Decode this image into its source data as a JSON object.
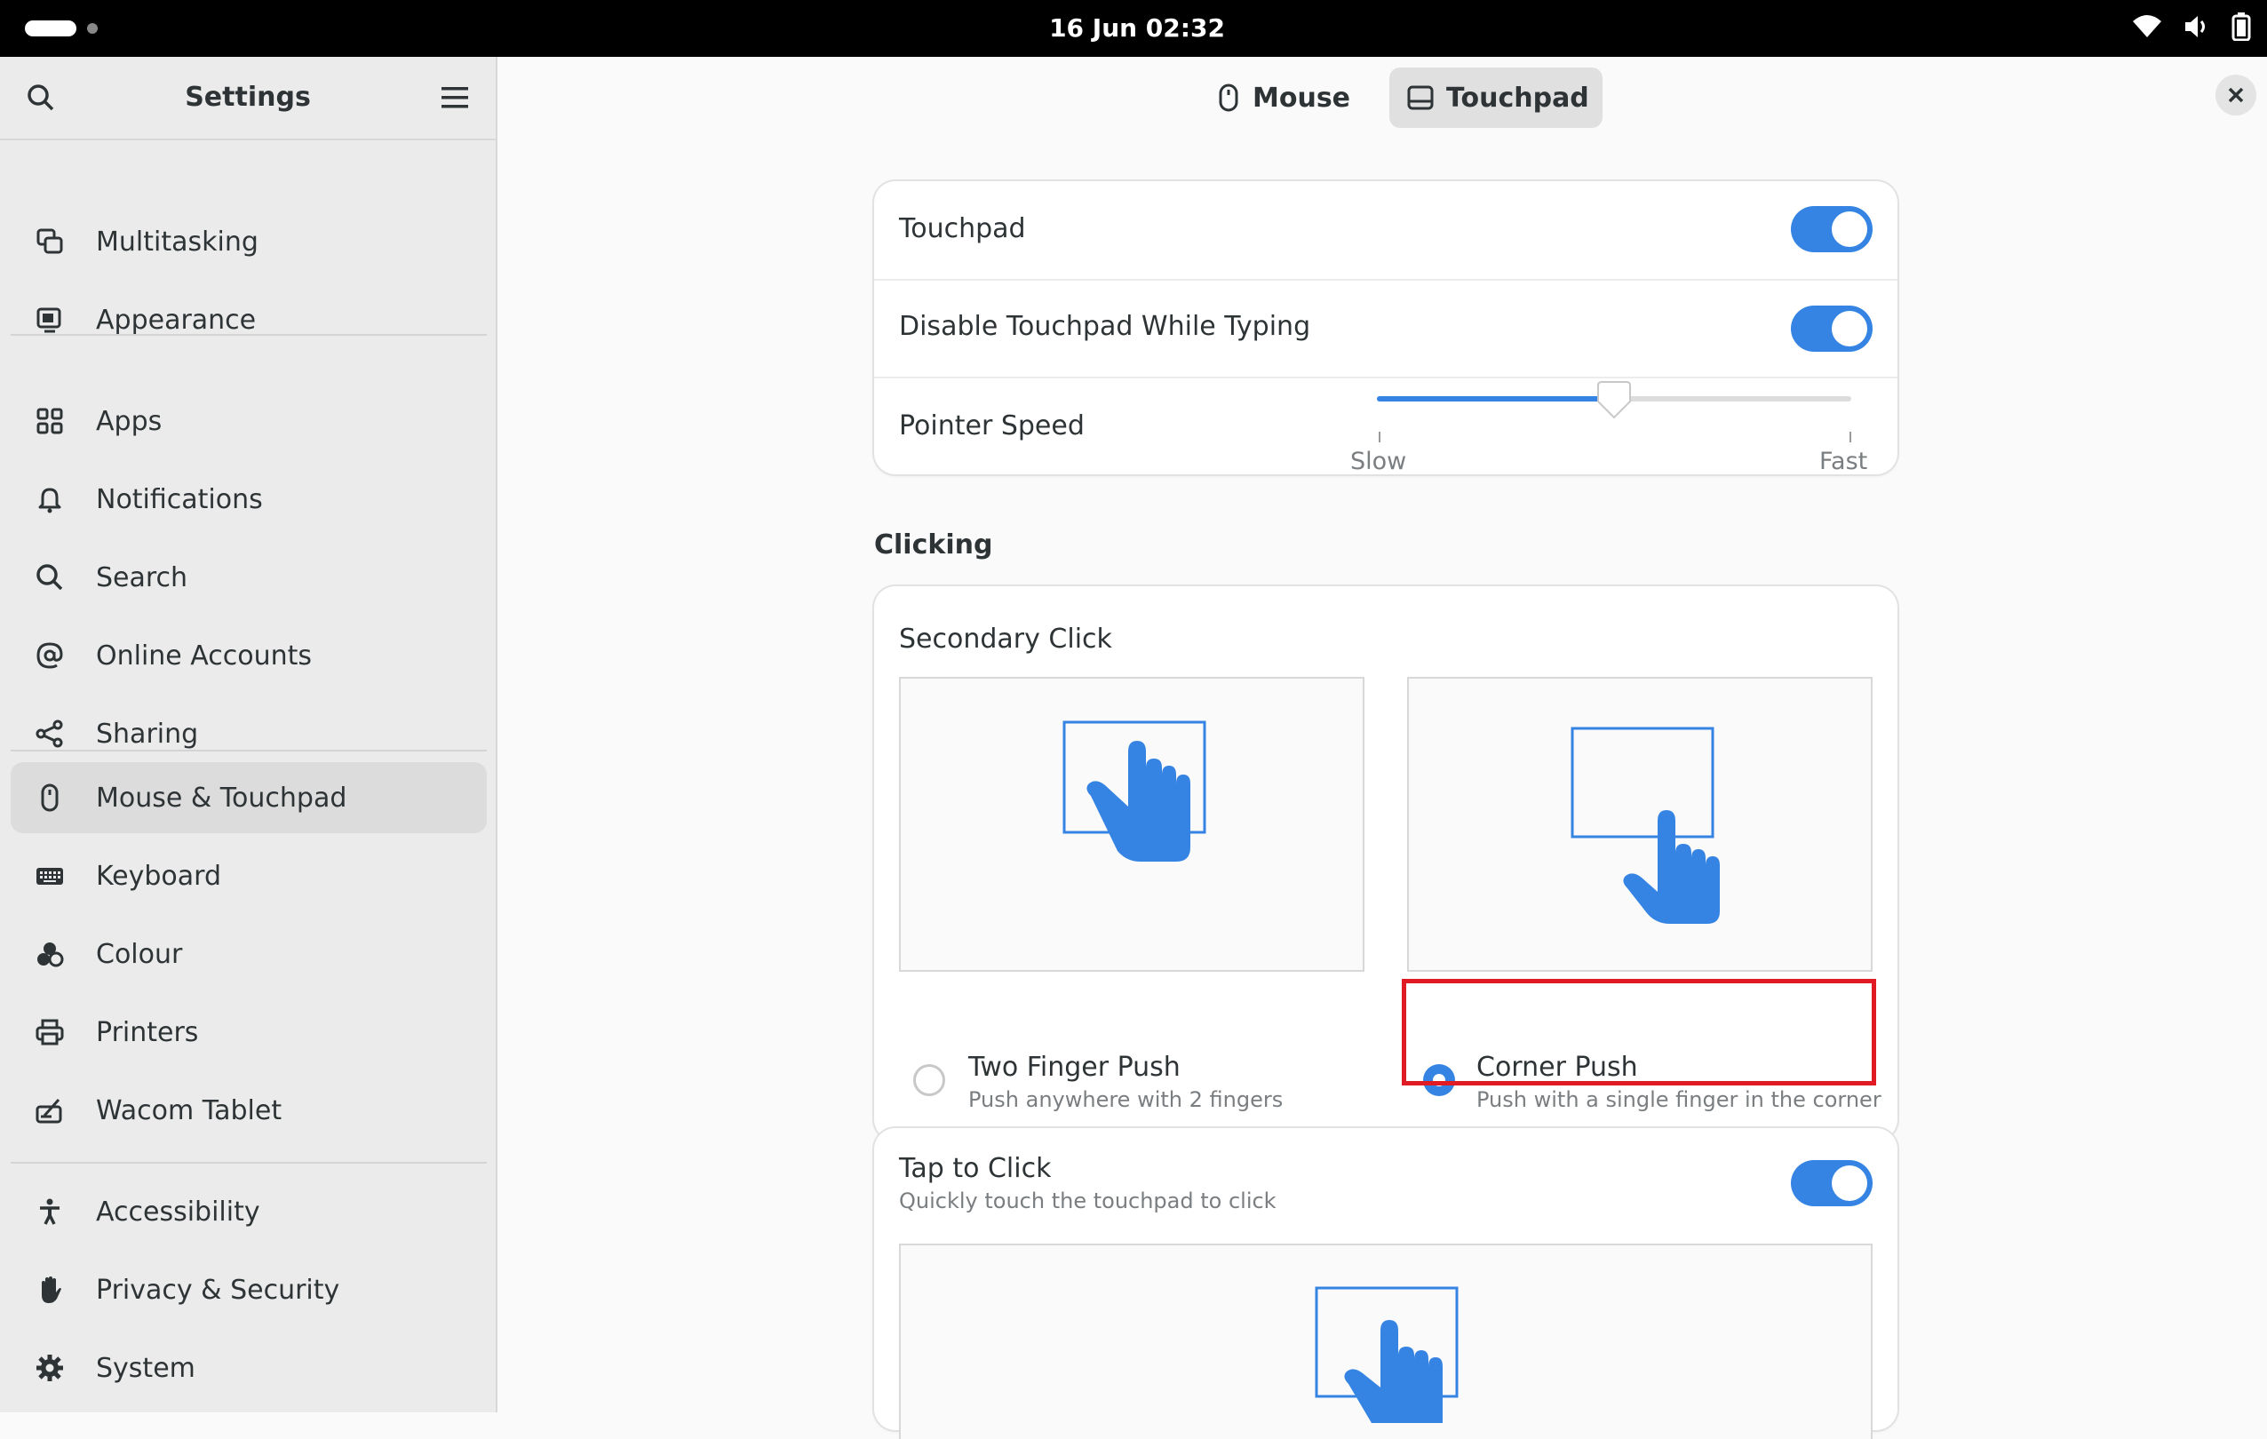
{
  "topbar": {
    "clock": "16 Jun  02:32",
    "icons": [
      "wifi-icon",
      "volume-icon",
      "battery-icon"
    ]
  },
  "sidebar": {
    "title": "Settings",
    "items": [
      {
        "label": "Multitasking",
        "icon": "multitasking-icon"
      },
      {
        "label": "Appearance",
        "icon": "appearance-icon"
      },
      {
        "label": "Apps",
        "icon": "apps-grid-icon"
      },
      {
        "label": "Notifications",
        "icon": "bell-icon"
      },
      {
        "label": "Search",
        "icon": "search-icon"
      },
      {
        "label": "Online Accounts",
        "icon": "at-sign-icon"
      },
      {
        "label": "Sharing",
        "icon": "share-icon"
      },
      {
        "label": "Mouse & Touchpad",
        "icon": "mouse-icon",
        "active": true
      },
      {
        "label": "Keyboard",
        "icon": "keyboard-icon"
      },
      {
        "label": "Colour",
        "icon": "colour-icon"
      },
      {
        "label": "Printers",
        "icon": "printer-icon"
      },
      {
        "label": "Wacom Tablet",
        "icon": "tablet-icon"
      },
      {
        "label": "Accessibility",
        "icon": "accessibility-icon"
      },
      {
        "label": "Privacy & Security",
        "icon": "hand-icon"
      },
      {
        "label": "System",
        "icon": "gear-icon"
      }
    ]
  },
  "tabs": [
    {
      "label": "Mouse",
      "active": false
    },
    {
      "label": "Touchpad",
      "active": true
    }
  ],
  "general": {
    "touchpad": {
      "label": "Touchpad",
      "enabled": true
    },
    "disable_while_typing": {
      "label": "Disable Touchpad While Typing",
      "enabled": true
    },
    "pointer_speed": {
      "label": "Pointer Speed",
      "min_label": "Slow",
      "max_label": "Fast",
      "value": 0.5
    }
  },
  "clicking": {
    "section_title": "Clicking",
    "secondary_click": {
      "label": "Secondary Click",
      "options": [
        {
          "title": "Two Finger Push",
          "subtitle": "Push anywhere with 2 fingers",
          "selected": false
        },
        {
          "title": "Corner Push",
          "subtitle": "Push with a single finger in the corner",
          "selected": true
        }
      ]
    },
    "tap_to_click": {
      "label": "Tap to Click",
      "subtitle": "Quickly touch the touchpad to click",
      "enabled": true
    }
  },
  "colors": {
    "accent": "#3584e4",
    "highlight": "#e01b24"
  }
}
